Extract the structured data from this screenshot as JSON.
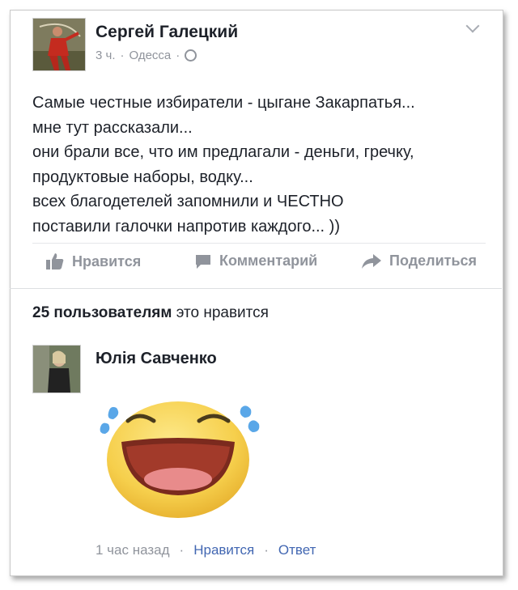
{
  "post": {
    "author": "Сергей Галецкий",
    "time": "3 ч.",
    "separator": "·",
    "location": "Одесса",
    "privacy_icon": "globe-icon",
    "text_lines": [
      "Самые честные избиратели - цыгане Закарпатья...",
      "мне тут рассказали...",
      "они брали все, что им предлагали - деньги, гречку,",
      "продуктовые наборы, водку...",
      "всех благодетелей запомнили и ЧЕСТНО",
      "поставили галочки напротив каждого... ))"
    ]
  },
  "actions": {
    "like": "Нравится",
    "comment": "Комментарий",
    "share": "Поделиться"
  },
  "likes": {
    "bold": "25 пользователям",
    "rest": " это нравится"
  },
  "comment": {
    "author": "Юлія Савченко",
    "sticker": "laughing-crying-emoji-sticker",
    "time": "1 час назад",
    "dot": "·",
    "like": "Нравится",
    "reply": "Ответ"
  },
  "colors": {
    "text": "#1d2129",
    "meta": "#90949c",
    "link": "#4267b2",
    "sticker_face": "#f7d25b",
    "tears": "#5aa7e8"
  }
}
